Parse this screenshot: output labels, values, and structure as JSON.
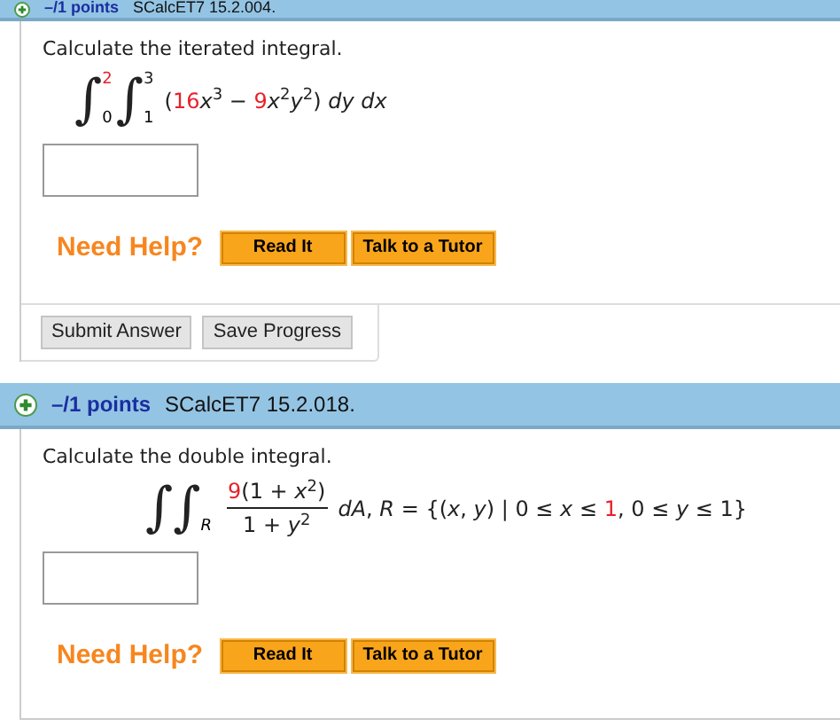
{
  "questions": [
    {
      "header": {
        "points": "–/1 points",
        "code": "SCalcET7 15.2.004."
      },
      "prompt": "Calculate the iterated integral.",
      "math": {
        "kind": "iterated",
        "signs": [
          {
            "sign": "∫",
            "lower": "0",
            "upper": "2",
            "upper_red": true
          },
          {
            "sign": "∫",
            "lower": "1",
            "upper": "3",
            "upper_red": false
          }
        ],
        "integrand": [
          {
            "text": "(",
            "red": false
          },
          {
            "text": "16",
            "red": true
          },
          {
            "text": "*x*$^{3}$ − ",
            "red": false
          },
          {
            "text": "9",
            "red": true
          },
          {
            "text": "*x*$^{2}$*y*$^{2}$) *dy dx*",
            "red": false
          }
        ]
      },
      "help": {
        "label": "Need Help?",
        "buttons": [
          "Read It",
          "Talk to a Tutor"
        ]
      },
      "actions": [
        "Submit Answer",
        "Save Progress"
      ]
    },
    {
      "header": {
        "points": "–/1 points",
        "code": "SCalcET7 15.2.018."
      },
      "prompt": "Calculate the double integral.",
      "math": {
        "kind": "double",
        "signs": "∫∫",
        "region": "R",
        "numerator": [
          {
            "text": "9",
            "red": true
          },
          {
            "text": "(1 + *x*$^{2}$)",
            "red": false
          }
        ],
        "denominator": [
          {
            "text": "1 + *y*$^{2}$",
            "red": false
          }
        ],
        "integrand": [
          {
            "text": "*dA*, *R* = {(*x*, *y*) | 0 ≤ *x* ≤ ",
            "red": false
          },
          {
            "text": "1",
            "red": true
          },
          {
            "text": ", 0 ≤ *y* ≤ 1}",
            "red": false
          }
        ]
      },
      "help": {
        "label": "Need Help?",
        "buttons": [
          "Read It",
          "Talk to a Tutor"
        ]
      }
    }
  ]
}
